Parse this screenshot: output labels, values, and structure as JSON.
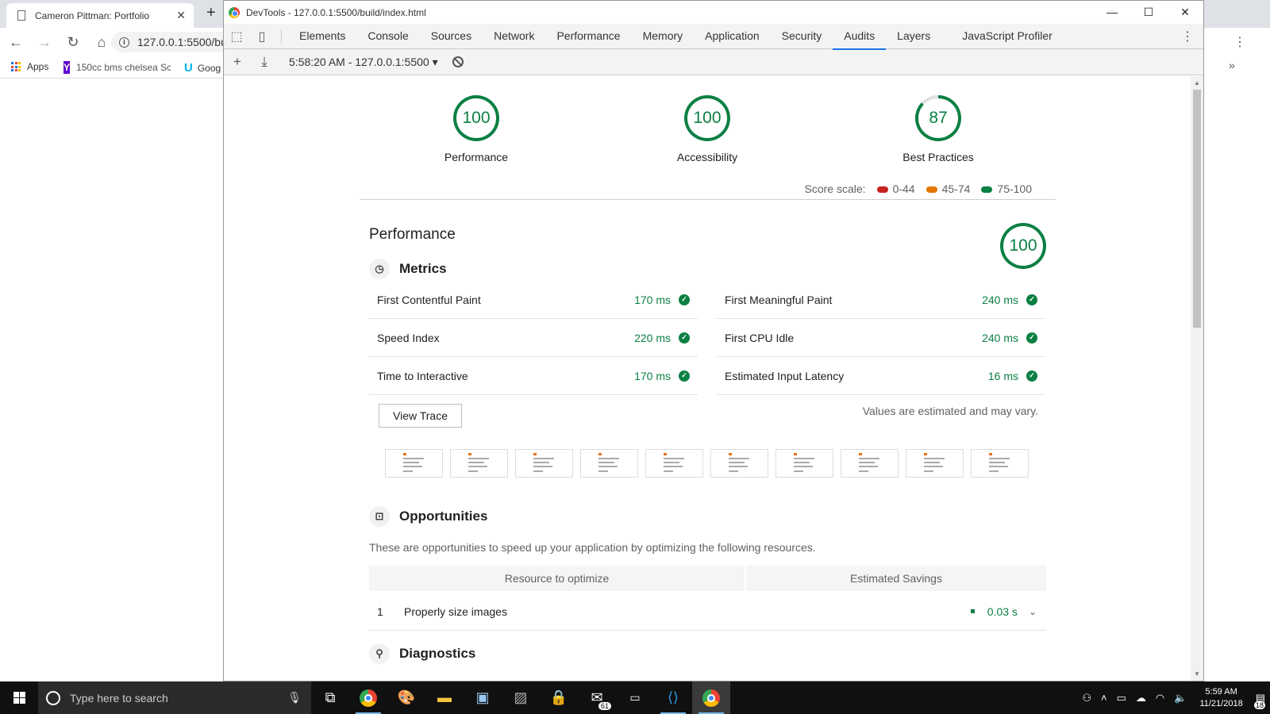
{
  "browser": {
    "tab_title": "Cameron Pittman: Portfolio",
    "tab_close": "✕",
    "new_tab": "+",
    "url": "127.0.0.1:5500/bui",
    "bookmarks": [
      "Apps",
      "150cc bms chelsea Sc",
      "Goog"
    ]
  },
  "devtools": {
    "window_title": "DevTools - 127.0.0.1:5500/build/index.html",
    "tabs": [
      "Elements",
      "Console",
      "Sources",
      "Network",
      "Performance",
      "Memory",
      "Application",
      "Security",
      "Audits",
      "Layers",
      "JavaScript Profiler"
    ],
    "active_tab": "Audits",
    "audit_run": "5:58:20 AM - 127.0.0.1:5500"
  },
  "report": {
    "gauges": [
      {
        "label": "Performance",
        "score": "100",
        "fraction": 1.0
      },
      {
        "label": "Accessibility",
        "score": "100",
        "fraction": 1.0
      },
      {
        "label": "Best Practices",
        "score": "87",
        "fraction": 0.87
      }
    ],
    "score_scale": {
      "label": "Score scale:",
      "ranges": [
        {
          "text": "0-44",
          "color": "#c5221f"
        },
        {
          "text": "45-74",
          "color": "#e67700"
        },
        {
          "text": "75-100",
          "color": "#0b8043"
        }
      ]
    },
    "performance": {
      "title": "Performance",
      "score": "100",
      "metrics_title": "Metrics",
      "metrics": [
        {
          "name": "First Contentful Paint",
          "value": "170 ms"
        },
        {
          "name": "First Meaningful Paint",
          "value": "240 ms"
        },
        {
          "name": "Speed Index",
          "value": "220 ms"
        },
        {
          "name": "First CPU Idle",
          "value": "240 ms"
        },
        {
          "name": "Time to Interactive",
          "value": "170 ms"
        },
        {
          "name": "Estimated Input Latency",
          "value": "16 ms"
        }
      ],
      "view_trace": "View Trace",
      "estimate_note": "Values are estimated and may vary.",
      "opportunities_title": "Opportunities",
      "opportunities_desc": "These are opportunities to speed up your application by optimizing the following resources.",
      "opp_col_resource": "Resource to optimize",
      "opp_col_savings": "Estimated Savings",
      "opportunities": [
        {
          "num": "1",
          "title": "Properly size images",
          "savings": "0.03 s"
        }
      ],
      "diagnostics_title": "Diagnostics"
    }
  },
  "taskbar": {
    "search_placeholder": "Type here to search",
    "mail_badge": "61",
    "time": "5:59 AM",
    "date": "11/21/2018",
    "notif_count": "18"
  },
  "colors": {
    "pass_green": "#0b8043",
    "accent_blue": "#1a73e8"
  }
}
